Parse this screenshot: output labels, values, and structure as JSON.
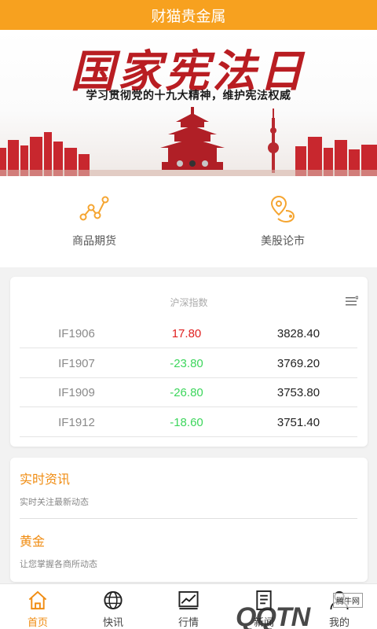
{
  "app": {
    "title": "财猫贵金属"
  },
  "banner": {
    "title": "国家宪法日",
    "subtitle": "学习贯彻党的十九大精神，维护宪法权威",
    "pages": 3,
    "active_page": 2
  },
  "quick_entries": [
    {
      "label": "商品期货",
      "icon": "nodes-icon"
    },
    {
      "label": "美股论市",
      "icon": "location-pin-icon"
    }
  ],
  "index_panel": {
    "title": "沪深指数",
    "rows": [
      {
        "code": "IF1906",
        "change": "17.80",
        "price": "3828.40"
      },
      {
        "code": "IF1907",
        "change": "-23.80",
        "price": "3769.20"
      },
      {
        "code": "IF1909",
        "change": "-26.80",
        "price": "3753.80"
      },
      {
        "code": "IF1912",
        "change": "-18.60",
        "price": "3751.40"
      }
    ],
    "colors": {
      "up": "#e02020",
      "down": "#3dd65c"
    }
  },
  "news": [
    {
      "title": "实时资讯",
      "subtitle": "实时关注最新动态"
    },
    {
      "title": "黄金",
      "subtitle": "让您掌握各商所动态"
    }
  ],
  "tabs": [
    {
      "label": "首页",
      "icon": "home-icon",
      "active": true
    },
    {
      "label": "快讯",
      "icon": "globe-icon",
      "active": false
    },
    {
      "label": "行情",
      "icon": "chart-icon",
      "active": false
    },
    {
      "label": "新闻",
      "icon": "news-icon",
      "active": false
    },
    {
      "label": "我的",
      "icon": "user-icon",
      "active": false
    }
  ],
  "watermark": {
    "text": "QQTN",
    "badge": "腾牛网"
  },
  "colors": {
    "accent": "#f7a11f",
    "tab_active": "#f08c12"
  }
}
